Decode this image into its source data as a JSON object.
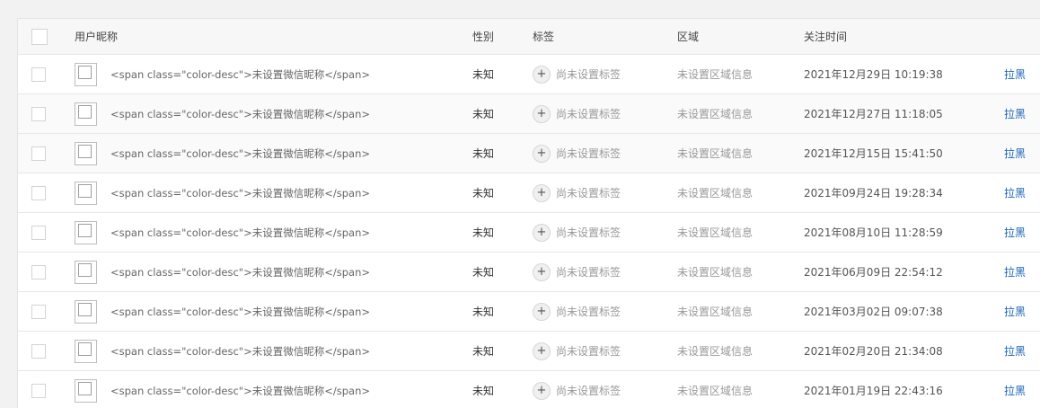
{
  "table": {
    "headers": {
      "nickname": "用户昵称",
      "gender": "性别",
      "tags": "标签",
      "region": "区域",
      "follow_time": "关注时间"
    },
    "rows": [
      {
        "nickname": "<span class=\"color-desc\">未设置微信昵称</span>",
        "gender": "未知",
        "tag_add": "+",
        "tags": "尚未设置标签",
        "region": "未设置区域信息",
        "follow_time": "2021年12月29日 10:19:38",
        "action": "拉黑"
      },
      {
        "nickname": "<span class=\"color-desc\">未设置微信昵称</span>",
        "gender": "未知",
        "tag_add": "+",
        "tags": "尚未设置标签",
        "region": "未设置区域信息",
        "follow_time": "2021年12月27日 11:18:05",
        "action": "拉黑"
      },
      {
        "nickname": "<span class=\"color-desc\">未设置微信昵称</span>",
        "gender": "未知",
        "tag_add": "+",
        "tags": "尚未设置标签",
        "region": "未设置区域信息",
        "follow_time": "2021年12月15日 15:41:50",
        "action": "拉黑"
      },
      {
        "nickname": "<span class=\"color-desc\">未设置微信昵称</span>",
        "gender": "未知",
        "tag_add": "+",
        "tags": "尚未设置标签",
        "region": "未设置区域信息",
        "follow_time": "2021年09月24日 19:28:34",
        "action": "拉黑"
      },
      {
        "nickname": "<span class=\"color-desc\">未设置微信昵称</span>",
        "gender": "未知",
        "tag_add": "+",
        "tags": "尚未设置标签",
        "region": "未设置区域信息",
        "follow_time": "2021年08月10日 11:28:59",
        "action": "拉黑"
      },
      {
        "nickname": "<span class=\"color-desc\">未设置微信昵称</span>",
        "gender": "未知",
        "tag_add": "+",
        "tags": "尚未设置标签",
        "region": "未设置区域信息",
        "follow_time": "2021年06月09日 22:54:12",
        "action": "拉黑"
      },
      {
        "nickname": "<span class=\"color-desc\">未设置微信昵称</span>",
        "gender": "未知",
        "tag_add": "+",
        "tags": "尚未设置标签",
        "region": "未设置区域信息",
        "follow_time": "2021年03月02日 09:07:38",
        "action": "拉黑"
      },
      {
        "nickname": "<span class=\"color-desc\">未设置微信昵称</span>",
        "gender": "未知",
        "tag_add": "+",
        "tags": "尚未设置标签",
        "region": "未设置区域信息",
        "follow_time": "2021年02月20日 21:34:08",
        "action": "拉黑"
      },
      {
        "nickname": "<span class=\"color-desc\">未设置微信昵称</span>",
        "gender": "未知",
        "tag_add": "+",
        "tags": "尚未设置标签",
        "region": "未设置区域信息",
        "follow_time": "2021年01月19日 22:43:16",
        "action": "拉黑"
      }
    ]
  },
  "colors": {
    "action_link": "#1a64b8",
    "muted_text": "#999999"
  }
}
